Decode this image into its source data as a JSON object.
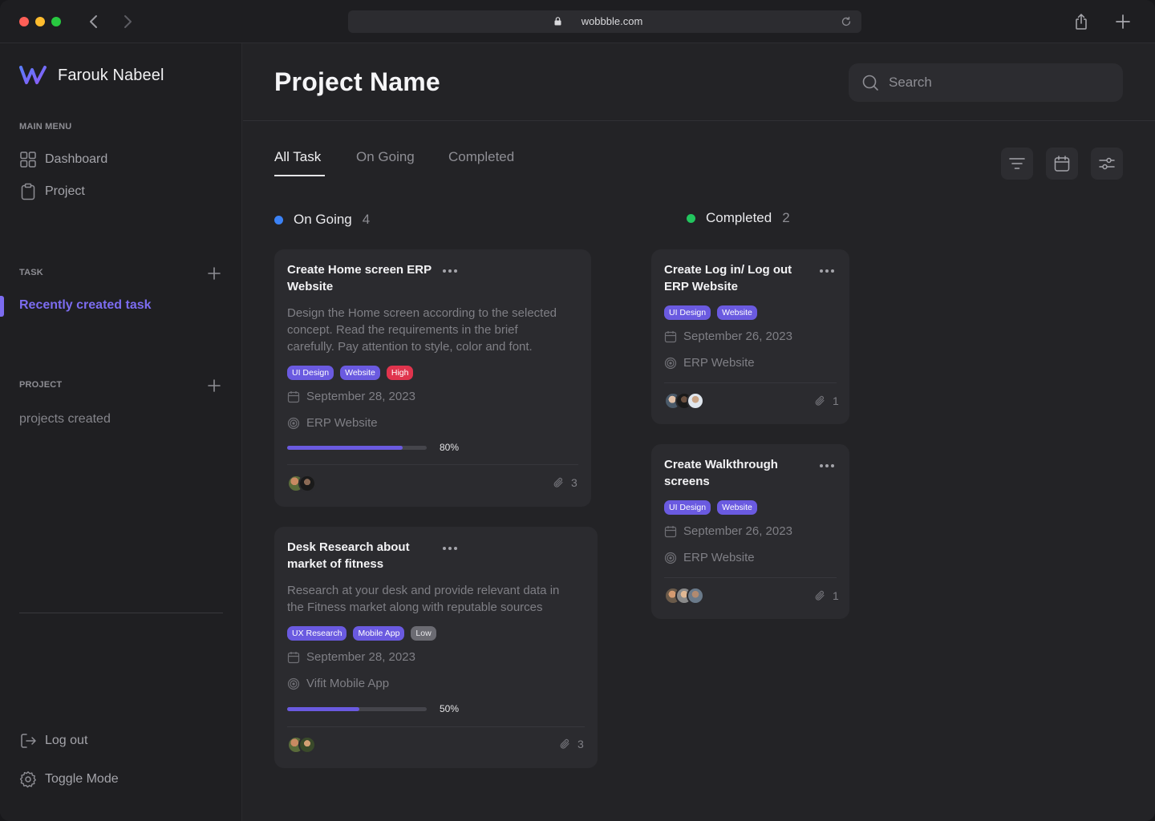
{
  "browser": {
    "url": "wobbble.com"
  },
  "colors": {
    "accent": "#7c6cf0",
    "ongoing_dot": "#3b82f6",
    "completed_dot": "#22c55e",
    "tag_purple": "#6a5ae0",
    "tag_high": "#e0344d",
    "tag_low": "#6b6b72"
  },
  "sidebar": {
    "brand": "Farouk Nabeel",
    "main_menu_heading": "MAIN MENU",
    "menu": [
      {
        "label": "Dashboard",
        "icon": "grid-icon"
      },
      {
        "label": "Project",
        "icon": "clipboard-icon"
      }
    ],
    "task_heading": "TASK",
    "recent_task": "Recently created task",
    "project_heading": "PROJECT",
    "projects_created": "projects created",
    "logout": "Log out",
    "toggle_mode": "Toggle Mode"
  },
  "header": {
    "title": "Project Name",
    "search_placeholder": "Search"
  },
  "tabs": [
    {
      "label": "All Task",
      "active": true
    },
    {
      "label": "On Going",
      "active": false
    },
    {
      "label": "Completed",
      "active": false
    }
  ],
  "columns": {
    "ongoing": {
      "label": "On Going",
      "count": "4",
      "cards": [
        {
          "title_line1": "Create Home screen ERP",
          "title_line2": "Website",
          "desc_lines": [
            "Design the Home screen according to the selected",
            "concept. Read the requirements in the brief",
            "carefully. Pay attention to style, color and font."
          ],
          "tags": [
            "UI Design",
            "Website",
            "High"
          ],
          "date": "September 28, 2023",
          "project": "ERP Website",
          "progress": 0.8,
          "progress_label": "80%",
          "attachments": "3"
        },
        {
          "title_line1": "Desk Research about",
          "title_line2": "market of fitness",
          "desc_lines": [
            "Research at your desk and provide relevant data in",
            "the Fitness market along with reputable sources"
          ],
          "tags": [
            "UX Research",
            "Mobile App",
            "Low"
          ],
          "date": "September 28, 2023",
          "project": "Vifit Mobile App",
          "progress": 0.5,
          "progress_label": "50%",
          "attachments": "3"
        }
      ]
    },
    "completed": {
      "label": "Completed",
      "count": "2",
      "cards": [
        {
          "title_line1": "Create Log in/ Log out",
          "title_line2": "ERP Website",
          "tags": [
            "UI Design",
            "Website"
          ],
          "date": "September 26, 2023",
          "project": "ERP Website",
          "attachments": "1"
        },
        {
          "title_line1": "Create Walkthrough",
          "title_line2": "screens",
          "tags": [
            "UI Design",
            "Website"
          ],
          "date": "September 26, 2023",
          "project": "ERP Website",
          "attachments": "1"
        }
      ]
    }
  }
}
